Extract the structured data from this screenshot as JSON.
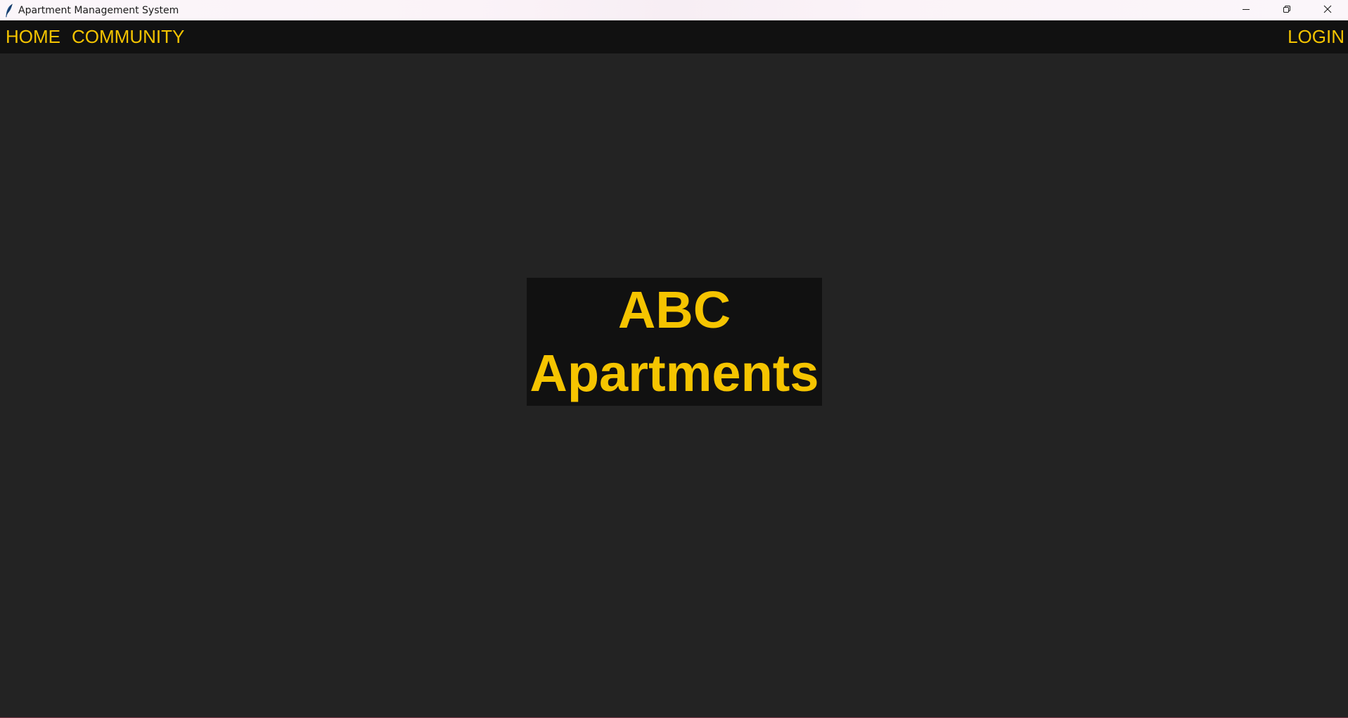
{
  "window": {
    "title": "Apartment Management System",
    "icon": "feather-icon",
    "controls": {
      "minimize_icon": "minimize-icon",
      "restore_icon": "restore-icon",
      "close_icon": "close-icon"
    }
  },
  "nav": {
    "home_label": "HOME",
    "community_label": "COMMUNITY",
    "login_label": "LOGIN"
  },
  "hero": {
    "line1": "ABC",
    "line2": "Apartments"
  },
  "colors": {
    "accent": "#f5c400",
    "navbar_bg": "#111111",
    "main_bg": "#232323",
    "brand_box_bg": "#111111"
  }
}
